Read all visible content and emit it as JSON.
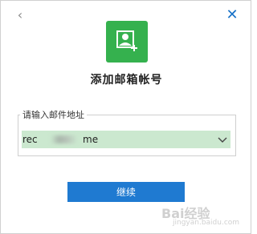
{
  "dialog": {
    "back_icon": "chevron-left-icon",
    "close_icon": "close-icon",
    "logo_icon": "add-user-icon",
    "title": "添加邮箱帐号",
    "field_label": "请输入邮件地址",
    "email_prefix": "rec",
    "email_suffix": "me",
    "continue_label": "继续",
    "colors": {
      "brand_green": "#35b14e",
      "accent_blue": "#1f7ad1",
      "input_bg": "#cbe8cf"
    }
  },
  "watermark": {
    "text": "Bai经验",
    "sub": "jingyan.baidu.com"
  }
}
